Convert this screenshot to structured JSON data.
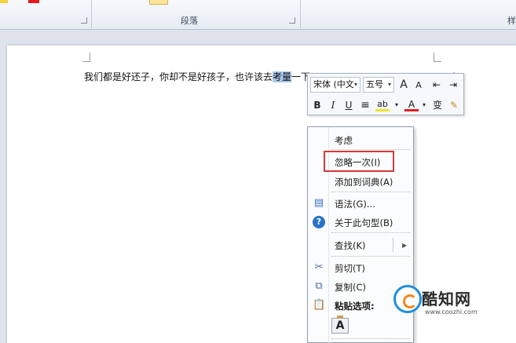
{
  "ribbon": {
    "paragraph_group_label": "段落",
    "styles_group_label_fragment": "样"
  },
  "document": {
    "text_before": "我们都是好还子，你却不是好孩子，也许该去",
    "text_selected": "考量",
    "text_after": "一下",
    "pilcrow": "↵"
  },
  "mini_toolbar": {
    "font_name": "宋体 (中文",
    "font_size": "五号",
    "grow_font": "A",
    "shrink_font": "A",
    "bold": "B",
    "italic": "I",
    "underline": "U",
    "center": "≡",
    "highlight": "ab",
    "font_color": "A",
    "phonetic": "变"
  },
  "context_menu": {
    "suggestion": "考虑",
    "ignore_once": "忽略一次(I)",
    "add_to_dictionary": "添加到词典(A)",
    "grammar": "语法(G)...",
    "about_sentence": "关于此句型(B)",
    "lookup": "查找(K)",
    "cut": "剪切(T)",
    "copy": "复制(C)",
    "paste_options": "粘贴选项:",
    "paste_keep_text": "A"
  },
  "watermark": {
    "title": "酷知网",
    "url": "www.coozhi.com"
  }
}
